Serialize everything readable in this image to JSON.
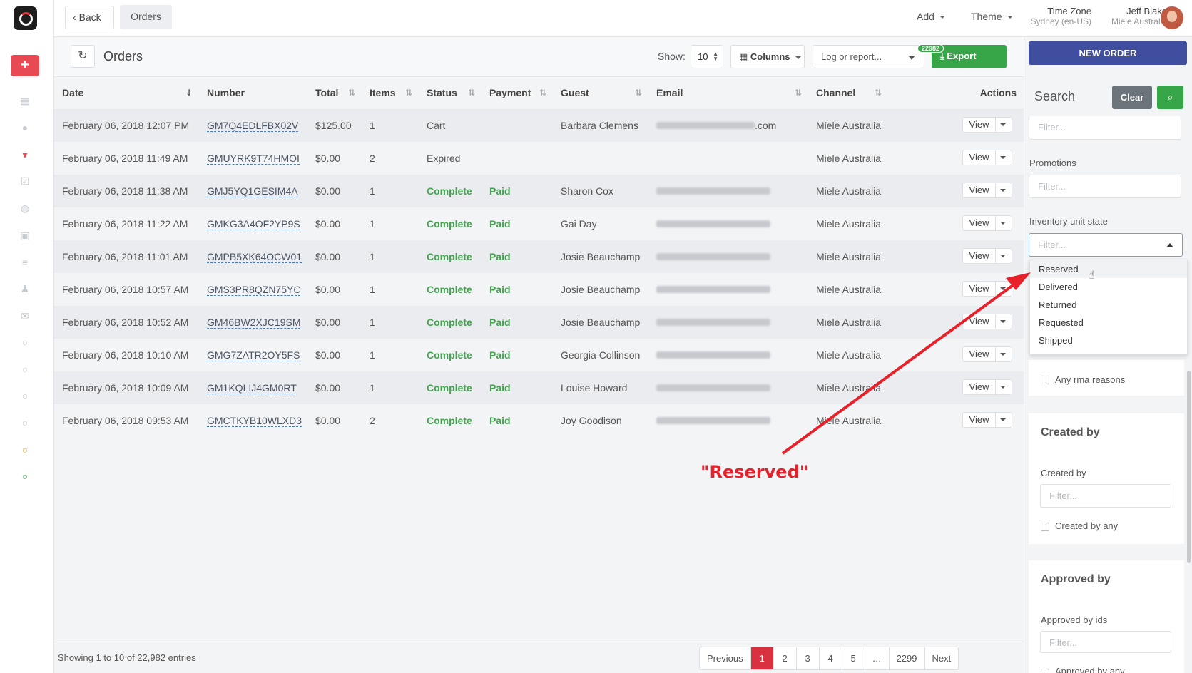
{
  "topbar": {
    "back_label": "Back",
    "crumb": "Orders",
    "add": "Add",
    "theme": "Theme",
    "tz_title": "Time Zone",
    "tz_value": "Sydney (en-US)",
    "user_name": "Jeff Blake",
    "user_org": "Miele Australia"
  },
  "orders_header": {
    "title": "Orders",
    "show_label": "Show:",
    "show_value": "10",
    "columns_label": "Columns",
    "log_placeholder": "Log or report...",
    "export_label": "Export",
    "export_count": "22982"
  },
  "table": {
    "columns": [
      "Date",
      "Number",
      "Total",
      "Items",
      "Status",
      "Payment",
      "Guest",
      "Email",
      "Channel",
      "Actions"
    ],
    "rows": [
      {
        "date": "February 06, 2018 12:07 PM",
        "number": "GM7Q4EDLFBX02V",
        "total": "$125.00",
        "items": "1",
        "status": "Cart",
        "payment": "",
        "guest": "Barbara Clemens",
        "email_suffix": ".com",
        "channel": "Miele Australia",
        "action": "View"
      },
      {
        "date": "February 06, 2018 11:49 AM",
        "number": "GMUYRK9T74HMOI",
        "total": "$0.00",
        "items": "2",
        "status": "Expired",
        "payment": "",
        "guest": "",
        "email_suffix": "",
        "channel": "Miele Australia",
        "action": "View"
      },
      {
        "date": "February 06, 2018 11:38 AM",
        "number": "GMJ5YQ1GESIM4A",
        "total": "$0.00",
        "items": "1",
        "status": "Complete",
        "payment": "Paid",
        "guest": "Sharon Cox",
        "email_suffix": "",
        "channel": "Miele Australia",
        "action": "View"
      },
      {
        "date": "February 06, 2018 11:22 AM",
        "number": "GMKG3A4OF2YP9S",
        "total": "$0.00",
        "items": "1",
        "status": "Complete",
        "payment": "Paid",
        "guest": "Gai Day",
        "email_suffix": "",
        "channel": "Miele Australia",
        "action": "View"
      },
      {
        "date": "February 06, 2018 11:01 AM",
        "number": "GMPB5XK64OCW01",
        "total": "$0.00",
        "items": "1",
        "status": "Complete",
        "payment": "Paid",
        "guest": "Josie Beauchamp",
        "email_suffix": "",
        "channel": "Miele Australia",
        "action": "View"
      },
      {
        "date": "February 06, 2018 10:57 AM",
        "number": "GMS3PR8QZN75YC",
        "total": "$0.00",
        "items": "1",
        "status": "Complete",
        "payment": "Paid",
        "guest": "Josie Beauchamp",
        "email_suffix": "",
        "channel": "Miele Australia",
        "action": "View"
      },
      {
        "date": "February 06, 2018 10:52 AM",
        "number": "GM46BW2XJC19SM",
        "total": "$0.00",
        "items": "1",
        "status": "Complete",
        "payment": "Paid",
        "guest": "Josie Beauchamp",
        "email_suffix": "",
        "channel": "Miele Australia",
        "action": "View"
      },
      {
        "date": "February 06, 2018 10:10 AM",
        "number": "GMG7ZATR2OY5FS",
        "total": "$0.00",
        "items": "1",
        "status": "Complete",
        "payment": "Paid",
        "guest": "Georgia Collinson",
        "email_suffix": "",
        "channel": "Miele Australia",
        "action": "View"
      },
      {
        "date": "February 06, 2018 10:09 AM",
        "number": "GM1KQLIJ4GM0RT",
        "total": "$0.00",
        "items": "1",
        "status": "Complete",
        "payment": "Paid",
        "guest": "Louise Howard",
        "email_suffix": "",
        "channel": "Miele Australia",
        "action": "View"
      },
      {
        "date": "February 06, 2018 09:53 AM",
        "number": "GMCTKYB10WLXD3",
        "total": "$0.00",
        "items": "2",
        "status": "Complete",
        "payment": "Paid",
        "guest": "Joy Goodison",
        "email_suffix": "",
        "channel": "Miele Australia",
        "action": "View"
      }
    ]
  },
  "footer": {
    "showing": "Showing 1 to 10 of 22,982 entries",
    "pages": [
      "Previous",
      "1",
      "2",
      "3",
      "4",
      "5",
      "…",
      "2299",
      "Next"
    ]
  },
  "sidebar": {
    "new_order": "NEW ORDER",
    "search_title": "Search",
    "clear": "Clear",
    "filter_placeholder": "Filter...",
    "promotions": "Promotions",
    "inventory_label": "Inventory unit state",
    "inventory_options": [
      "Reserved",
      "Delivered",
      "Returned",
      "Requested",
      "Shipped"
    ],
    "any_rma": "Any rma reasons",
    "created_by_title": "Created by",
    "created_by_label": "Created by",
    "created_by_any": "Created by any",
    "approved_by_title": "Approved by",
    "approved_by_ids": "Approved by ids",
    "approved_by_any": "Approved by any"
  },
  "annotation": "\"Reserved\"",
  "colors": {
    "accent_blue": "#3f4e9e",
    "green": "#36a648",
    "red": "#e74a53",
    "annotation_red": "#e8202a"
  }
}
